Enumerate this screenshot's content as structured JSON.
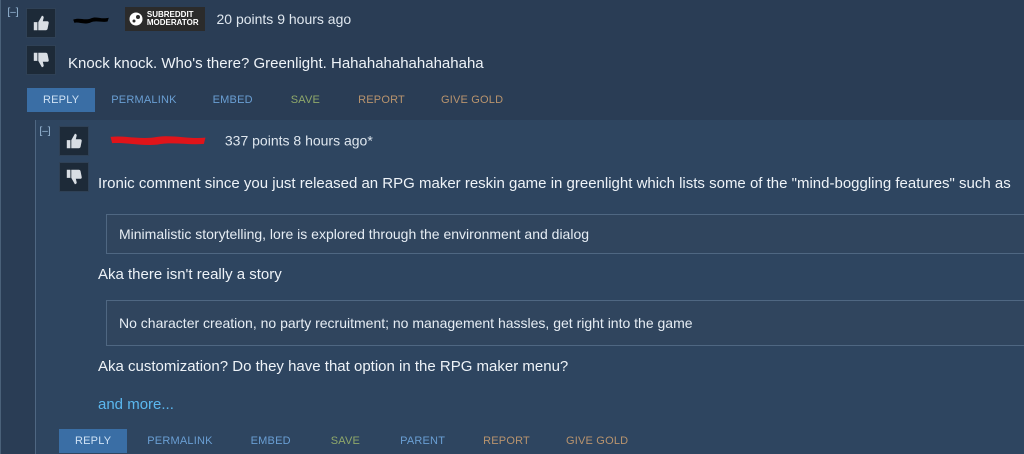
{
  "comment": {
    "collapse_label": "[–]",
    "badge_line1": "SUBREDDIT",
    "badge_line2": "MODERATOR",
    "meta": "20 points 9 hours ago",
    "text": "Knock knock. Who's there? Greenlight. Hahahahahahahahaha",
    "actions": [
      "REPLY",
      "PERMALINK",
      "EMBED",
      "SAVE",
      "REPORT",
      "GIVE GOLD"
    ]
  },
  "reply": {
    "collapse_label": "[–]",
    "meta": "337 points 8 hours ago*",
    "paragraph1": "Ironic comment since you just released an RPG maker reskin game in greenlight which lists some of the \"mind-boggling features\" such as",
    "quote1": "Minimalistic storytelling, lore is explored through the environment and dialog",
    "paragraph2": "Aka there isn't really a story",
    "quote2": "No character creation, no party recruitment; no management hassles, get right into the game",
    "paragraph3": "Aka customization? Do they have that option in the RPG maker menu?",
    "more_link": "and more...",
    "actions": [
      "REPLY",
      "PERMALINK",
      "EMBED",
      "SAVE",
      "PARENT",
      "REPORT",
      "GIVE GOLD"
    ]
  }
}
